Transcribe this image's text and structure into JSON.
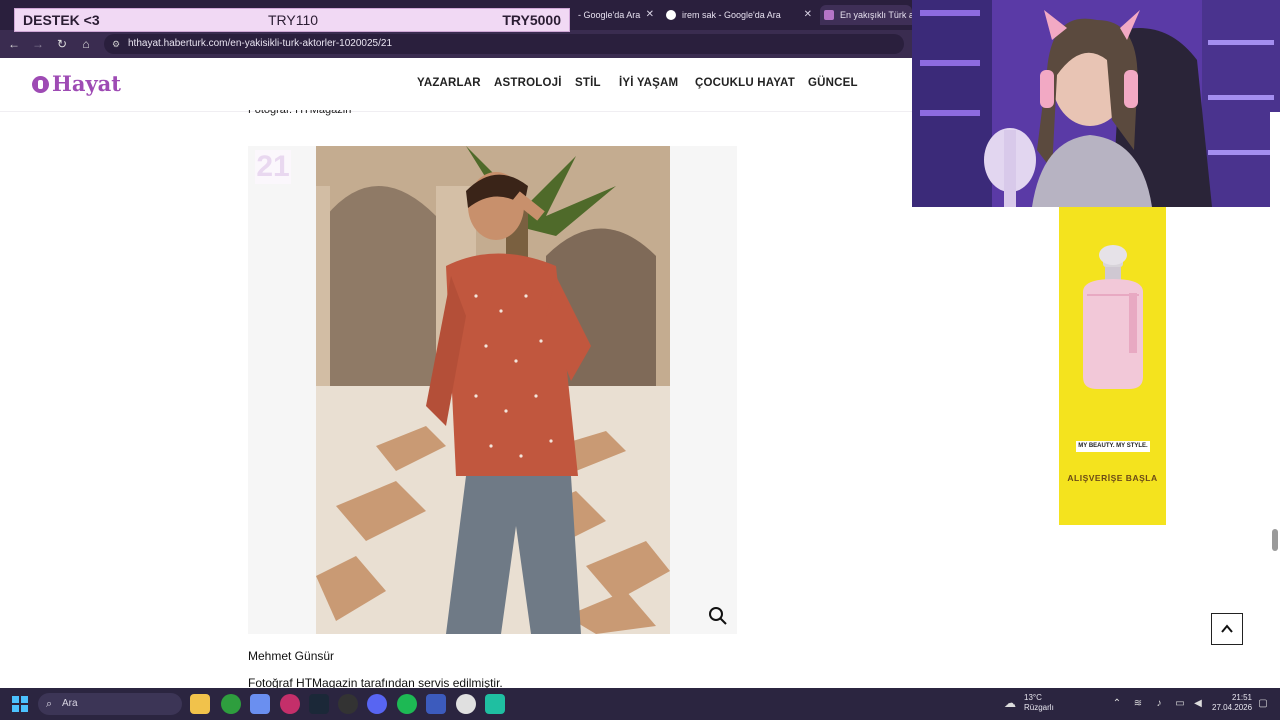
{
  "browser": {
    "tabs": [
      {
        "title": "- Google'da Ara"
      },
      {
        "title": "irem sak - Google'da Ara"
      },
      {
        "title": "En yakışıklı Türk akt"
      }
    ],
    "url": "hthayat.haberturk.com/en-yakisikli-turk-aktorler-1020025/21"
  },
  "overlay": {
    "label": "DESTEK <3",
    "current": "TRY110",
    "goal": "TRY5000"
  },
  "site": {
    "logo": "Hayat",
    "nav": [
      "YAZARLAR",
      "ASTROLOJİ",
      "STİL",
      "İYİ YAŞAM",
      "ÇOCUKLU HAYAT",
      "GÜNCEL"
    ]
  },
  "article": {
    "caption_top": "Fotoğraf: HTMagazin",
    "gallery_number": "21",
    "person_name": "Mehmet Günsür",
    "credit": "Fotoğraf HTMagazin tarafından servis edilmiştir."
  },
  "ad": {
    "tagline": "MY BEAUTY. MY STYLE.",
    "cta": "ALIŞVERİŞE BAŞLA"
  },
  "taskbar": {
    "search_placeholder": "Ara",
    "weather_temp": "13°C",
    "weather_desc": "Rüzgarlı",
    "time": "21:51",
    "date": "27.04.2026"
  },
  "colors": {
    "brand": "#9e4bb4",
    "ad_bg": "#f4e31e",
    "taskbar": "#2b2540"
  }
}
